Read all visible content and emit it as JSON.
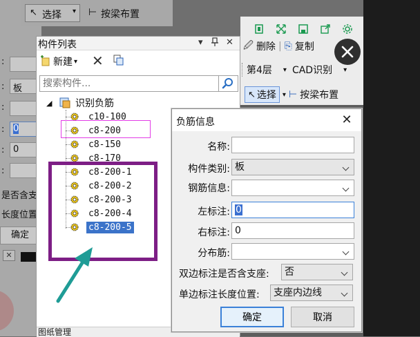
{
  "background_left": {
    "top_select_label": "选择",
    "top_button_label": "按梁布置",
    "field_value_1": "板",
    "field_value_2": "0",
    "field_value_3": "0",
    "label_support": "是否含支",
    "label_length_pos": "长度位置",
    "ok_label": "确定",
    "small_close": "✕"
  },
  "component_panel": {
    "title": "构件列表",
    "pin_icon": "pin-icon",
    "close_icon": "close-icon",
    "new_label": "新建",
    "search_placeholder": "搜索构件...",
    "tree_root": "识别负筋",
    "items": [
      {
        "label": "c10-100"
      },
      {
        "label": "c8-200"
      },
      {
        "label": "c8-150"
      },
      {
        "label": "c8-170"
      },
      {
        "label": "c8-200-1"
      },
      {
        "label": "c8-200-2"
      },
      {
        "label": "c8-200-3"
      },
      {
        "label": "c8-200-4"
      },
      {
        "label": "c8-200-5"
      }
    ],
    "selected_index": 8,
    "bottom_tab": "图纸管理"
  },
  "cad_toolbar": {
    "delete_label": "删除",
    "copy_label": "复制",
    "floor_label": "第4层",
    "cad_recognize_label": "CAD识别",
    "select_label": "选择",
    "beam_layout_label": "按梁布置"
  },
  "dialog": {
    "title": "负筋信息",
    "close_icon": "close-icon",
    "fields": {
      "name_label": "名称:",
      "name_value": "",
      "type_label": "构件类别:",
      "type_value": "板",
      "rebar_label": "钢筋信息:",
      "rebar_value": "",
      "left_label": "左标注:",
      "left_value": "0",
      "right_label": "右标注:",
      "right_value": "0",
      "dist_label": "分布筋:",
      "dist_value": "",
      "double_label": "双边标注是否含支座:",
      "double_value": "否",
      "single_label": "单边标注长度位置:",
      "single_value": "支座内边线"
    },
    "ok_label": "确定",
    "cancel_label": "取消"
  },
  "colors": {
    "annotation_purple": "#7d1e85",
    "annotation_pink": "#e23ce6",
    "annotation_arrow": "#1f9c96",
    "selection_blue": "#3b73c9"
  }
}
